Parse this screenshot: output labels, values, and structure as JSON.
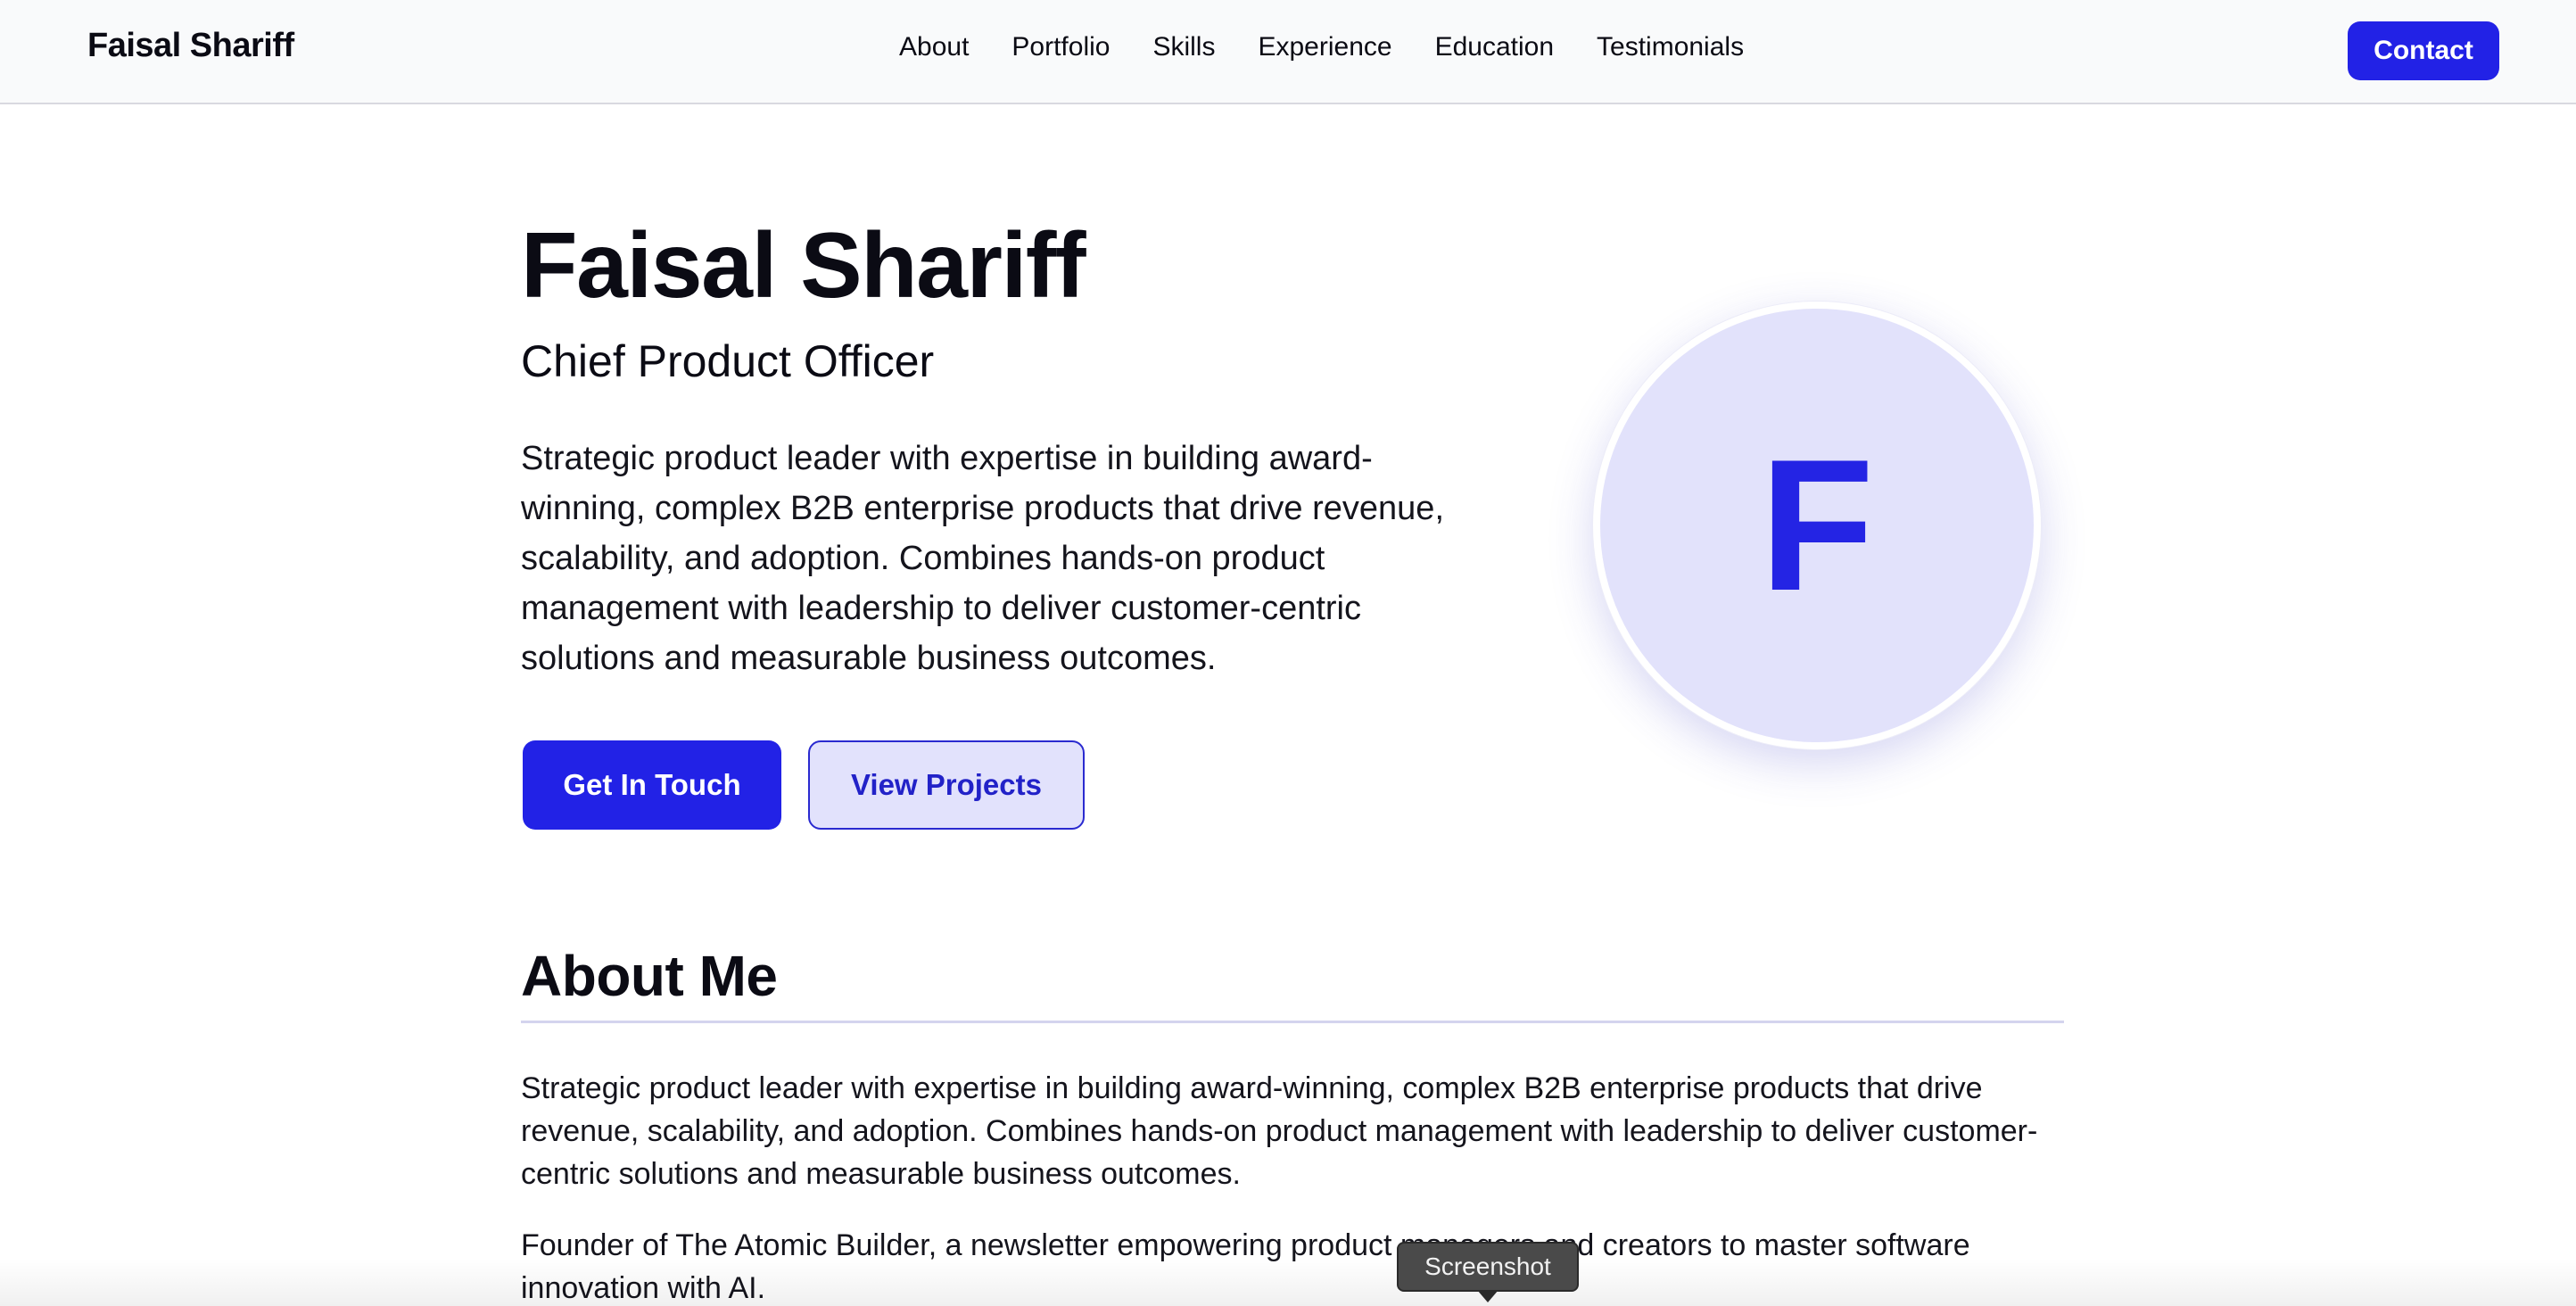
{
  "navbar": {
    "brand": "Faisal Shariff",
    "links": [
      "About",
      "Portfolio",
      "Skills",
      "Experience",
      "Education",
      "Testimonials"
    ],
    "contact_label": "Contact"
  },
  "hero": {
    "name": "Faisal Shariff",
    "title": "Chief Product Officer",
    "description": "Strategic product leader with expertise in building award-winning, complex B2B enterprise products that drive revenue, scalability, and adoption. Combines hands-on product management with leadership to deliver customer-centric solutions and measurable business outcomes.",
    "primary_button": "Get In Touch",
    "secondary_button": "View Projects",
    "avatar_initial": "F"
  },
  "about": {
    "heading": "About Me",
    "paragraphs": [
      "Strategic product leader with expertise in building award-winning, complex B2B enterprise products that drive revenue, scalability, and adoption. Combines hands-on product management with leadership to deliver customer-centric solutions and measurable business outcomes.",
      "Founder of The Atomic Builder, a newsletter empowering product managers and creators to master software innovation with AI."
    ]
  },
  "tooltip": {
    "label": "Screenshot"
  },
  "colors": {
    "accent": "#2222e6",
    "accent_light": "#e2e2fc",
    "nav_background": "#f9fafb"
  }
}
